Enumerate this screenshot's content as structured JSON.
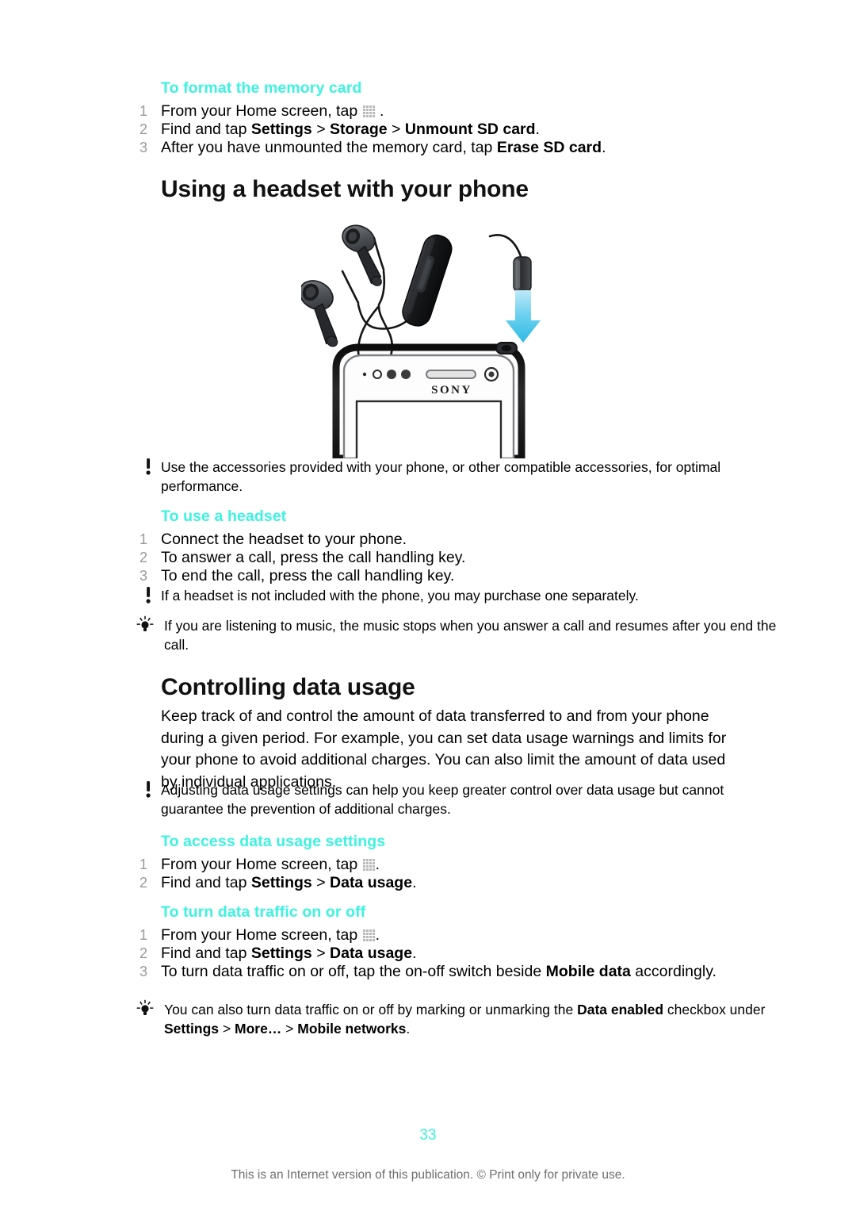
{
  "document": {
    "page_number": "33",
    "footer_note": "This is an Internet version of this publication. © Print only for private use.",
    "accent_color": "#3CF3DF"
  },
  "sections": {
    "format_memory_card": {
      "heading": "To format the memory card",
      "steps": [
        {
          "num": "1",
          "pre": "From your Home screen, tap ",
          "icon": "app-drawer-icon",
          "post": " ."
        },
        {
          "num": "2",
          "pre": "Find and tap ",
          "bold1": "Settings",
          "sep1": " > ",
          "bold2": "Storage",
          "sep2": " > ",
          "bold3": "Unmount SD card",
          "post": "."
        },
        {
          "num": "3",
          "pre": "After you have unmounted the memory card, tap ",
          "bold1": "Erase SD card",
          "post": "."
        }
      ]
    },
    "headset": {
      "title": "Using a headset with your phone",
      "illustration": {
        "name": "headset-and-phone-illustration",
        "alt_parts": [
          "in-ear-headset",
          "inline-remote",
          "3.5mm-jack-plug",
          "blue-arrow-down",
          "sony-phone-top"
        ],
        "phone_brand": "SONY",
        "arrow_color": "#4FC8ED"
      },
      "note_accessories": "Use the accessories provided with your phone, or other compatible accessories, for optimal performance.",
      "use_headset_heading": "To use a headset",
      "use_headset_steps": [
        {
          "num": "1",
          "text": "Connect the headset to your phone."
        },
        {
          "num": "2",
          "text": "To answer a call, press the call handling key."
        },
        {
          "num": "3",
          "text": "To end the call, press the call handling key."
        }
      ],
      "note_not_included": "If a headset is not included with the phone, you may purchase one separately.",
      "tip_music": "If you are listening to music, the music stops when you answer a call and resumes after you end the call."
    },
    "data_usage": {
      "title": "Controlling data usage",
      "intro": "Keep track of and control the amount of data transferred to and from your phone during a given period. For example, you can set data usage warnings and limits for your phone to avoid additional charges. You can also limit the amount of data used by individual applications.",
      "note_adjusting": "Adjusting data usage settings can help you keep greater control over data usage but cannot guarantee the prevention of additional charges.",
      "access_heading": "To access data usage settings",
      "access_steps": [
        {
          "num": "1",
          "pre": "From your Home screen, tap ",
          "icon": "app-drawer-icon",
          "post": "."
        },
        {
          "num": "2",
          "pre": "Find and tap ",
          "bold1": "Settings",
          "sep1": " > ",
          "bold2": "Data usage",
          "post": "."
        }
      ],
      "traffic_heading": "To turn data traffic on or off",
      "traffic_steps": [
        {
          "num": "1",
          "pre": "From your Home screen, tap ",
          "icon": "app-drawer-icon",
          "post": "."
        },
        {
          "num": "2",
          "pre": "Find and tap ",
          "bold1": "Settings",
          "sep1": " > ",
          "bold2": "Data usage",
          "post": "."
        },
        {
          "num": "3",
          "pre": "To turn data traffic on or off, tap the on-off switch beside ",
          "bold1": "Mobile data",
          "post": " accordingly."
        }
      ],
      "tip_checkbox": {
        "part1": "You can also turn data traffic on or off by marking or unmarking the ",
        "bold1": "Data enabled",
        "part2": " checkbox under ",
        "bold2": "Settings",
        "sep1": " > ",
        "bold3": "More…",
        "sep2": " > ",
        "bold4": "Mobile networks",
        "part3": "."
      }
    }
  }
}
